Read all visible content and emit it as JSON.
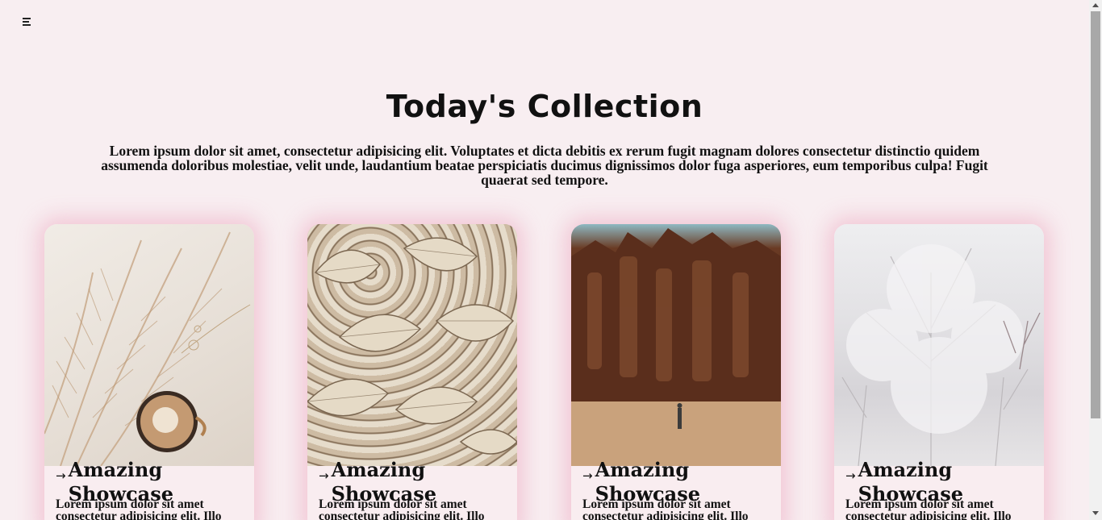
{
  "menu": {
    "icon": "hamburger-menu-icon"
  },
  "hero": {
    "title": "Today's Collection",
    "text": "Lorem ipsum dolor sit amet, consectetur adipisicing elit. Voluptates et dicta debitis ex rerum fugit magnam dolores consectetur distinctio quidem assumenda doloribus molestiae, velit unde, laudantium beatae perspiciatis ducimus dignissimos dolor fuga asperiores, eum temporibus culpa! Fugit quaerat sed tempore."
  },
  "cards": [
    {
      "title": "Amazing Showcase",
      "text": "Lorem ipsum dolor sit amet consectetur adipisicing elit. Illo",
      "image": "pampas-coffee-image"
    },
    {
      "title": "Amazing Showcase",
      "text": "Lorem ipsum dolor sit amet consectetur adipisicing elit. Illo",
      "image": "palm-leaves-image"
    },
    {
      "title": "Amazing Showcase",
      "text": "Lorem ipsum dolor sit amet consectetur adipisicing elit. Illo",
      "image": "desert-cliffs-image"
    },
    {
      "title": "Amazing Showcase",
      "text": "Lorem ipsum dolor sit amet consectetur adipisicing elit. Illo",
      "image": "snowy-trees-image"
    }
  ],
  "colors": {
    "background": "#f8eef1",
    "card_glow": "#ec96b4",
    "text": "#111111"
  }
}
